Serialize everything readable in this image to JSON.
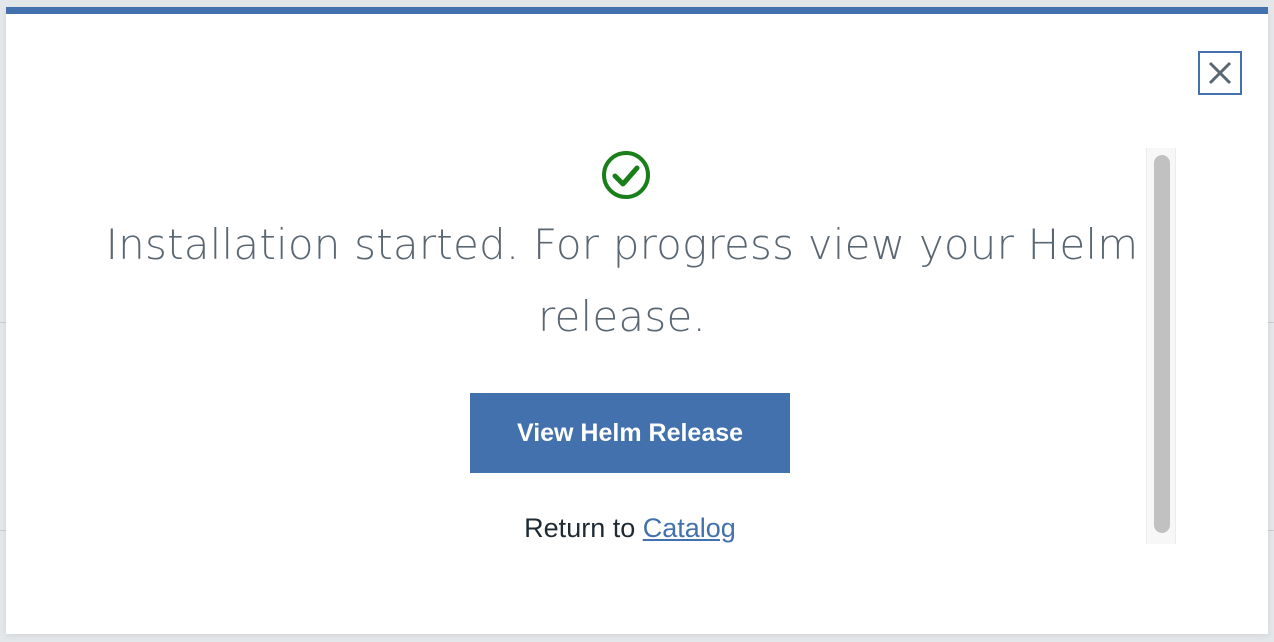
{
  "modal": {
    "close_icon": "close-icon",
    "success_icon": "check-circle-icon",
    "message": "Installation started. For progress view your Helm release.",
    "primary_button_label": "View Helm Release",
    "return_prefix": "Return to ",
    "return_link_label": "Catalog"
  },
  "colors": {
    "accent": "#4271ae",
    "success": "#1a7f1a",
    "message_text": "#5a6772"
  }
}
